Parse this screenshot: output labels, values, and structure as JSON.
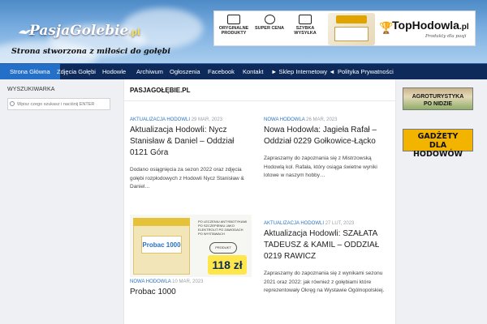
{
  "header": {
    "logo_name": "PasjaGolebie",
    "logo_tld": ".pl",
    "tagline": "Strona stworzona z miłości do gołębi",
    "banner": {
      "feature1": "ORYGINALNE PRODUKTY",
      "feature2": "SUPER CENA",
      "feature3": "SZYBKA WYSYŁKA",
      "brand": "TopHodowla",
      "brand_tld": ".pl",
      "slogan": "Produkty dla pasji"
    }
  },
  "nav": {
    "items": [
      {
        "label": "Strona Główna",
        "active": true
      },
      {
        "label": "Zdjęcia Gołębi"
      },
      {
        "label": "Hodowle"
      },
      {
        "label": "Archiwum"
      },
      {
        "label": "Ogłoszenia"
      },
      {
        "label": "Facebook"
      },
      {
        "label": "Kontakt"
      },
      {
        "label": "► Sklep Internetowy ◄"
      },
      {
        "label": "Polityka Prywatności"
      }
    ]
  },
  "sidebar_left": {
    "title": "WYSZUKIWARKA",
    "search_placeholder": "Wpisz czego szukasz i naciśnij ENTER"
  },
  "main": {
    "heading": "PASJAGOŁĘBIE.PL",
    "posts": [
      {
        "category": "AKTUALIZACJA HODOWLI",
        "date": "29 MAR, 2023",
        "title": "Aktualizacja Hodowli: Nycz Stanisław & Daniel – Oddział 0121 Góra",
        "excerpt": "Dodano osiągnięcia za sezon 2022 oraz zdjęcia gołębi rozpłodowych z Hodowli Nycz Stanisław & Daniel…"
      },
      {
        "category": "NOWA HODOWLA",
        "date": "26 MAR, 2023",
        "title": "Nowa Hodowla: Jagieła Rafał – Oddział 0229 Gołkowice-Łącko",
        "excerpt": "Zapraszamy do zapoznania się z Mistrzowską Hodowlą kol. Rafała, który osiąga świetne wyniki lotowe w naszym hobby…"
      },
      {
        "category": "NOWA HODOWLA",
        "date": "10 MAR, 2023",
        "title": "Probac 1000",
        "thumb_label": "Probac 1000",
        "thumb_text": "PO LECZENIU ANTYBIOTYKAMI PO SZCZEPIENIU JAKO ELEKTROLIT PO ZAWODACH PO WYSTAWACH",
        "thumb_badge": "PRODUKT ORYGINALNY",
        "thumb_price": "118 zł"
      },
      {
        "category": "AKTUALIZACJA HODOWLI",
        "date": "27 LUT, 2023",
        "title": "Aktualizacja Hodowli: SZAŁATA TADEUSZ & KAMIL – ODDZIAŁ 0219 RAWICZ",
        "excerpt": "Zapraszamy do zapoznania się z wynikami sezonu 2021 oraz 2022: jak również z gołębiami które reprezentowały Okręg na Wystawie Ogólnopolskiej."
      }
    ]
  },
  "sidebar_right": {
    "ad1_line1": "AGROTURYSTYKA",
    "ad1_line2": "PO NIDZIE",
    "ad2_line1": "GADŻETY",
    "ad2_line2": "DLA HODOWÓW"
  }
}
